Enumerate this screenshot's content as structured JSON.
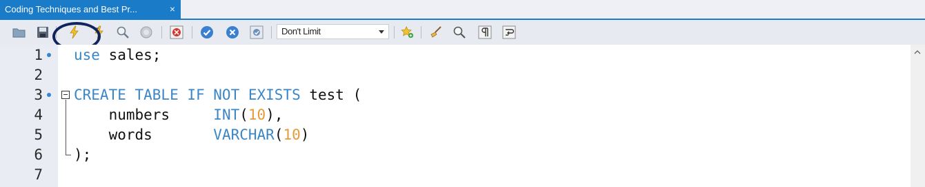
{
  "tab": {
    "title": "Coding Techniques and Best Pr...",
    "close": "×"
  },
  "toolbar": {
    "limit_select": {
      "value": "Don't Limit"
    },
    "icons": [
      "open-folder-icon",
      "save-icon",
      "execute-lightning-icon",
      "execute-current-lightning-icon",
      "explain-magnifier-icon",
      "stop-icon",
      "toggle-error-icon",
      "commit-check-icon",
      "rollback-x-icon",
      "autocommit-icon",
      "bookmark-star-icon",
      "beautify-broom-icon",
      "find-icon",
      "invisible-chars-icon",
      "wrap-icon"
    ]
  },
  "editor": {
    "lines": [
      {
        "number": "1",
        "tokens": [
          {
            "t": "use",
            "c": "kw"
          },
          {
            "t": " sales;",
            "c": ""
          }
        ]
      },
      {
        "number": "2",
        "tokens": []
      },
      {
        "number": "3",
        "tokens": [
          {
            "t": "CREATE TABLE IF NOT EXISTS",
            "c": "kw"
          },
          {
            "t": " test (",
            "c": ""
          }
        ]
      },
      {
        "number": "4",
        "tokens": [
          {
            "t": "    numbers     ",
            "c": ""
          },
          {
            "t": "INT",
            "c": "kw"
          },
          {
            "t": "(",
            "c": ""
          },
          {
            "t": "10",
            "c": "num"
          },
          {
            "t": "),",
            "c": ""
          }
        ]
      },
      {
        "number": "5",
        "tokens": [
          {
            "t": "    words       ",
            "c": ""
          },
          {
            "t": "VARCHAR",
            "c": "kw"
          },
          {
            "t": "(",
            "c": ""
          },
          {
            "t": "10",
            "c": "num"
          },
          {
            "t": ")",
            "c": ""
          }
        ]
      },
      {
        "number": "6",
        "tokens": [
          {
            "t": ");",
            "c": ""
          }
        ]
      },
      {
        "number": "7",
        "tokens": []
      }
    ],
    "breakpoints": [
      "1",
      "3"
    ]
  },
  "colors": {
    "tab_active": "#1a7bc9",
    "keyword": "#3a86c6",
    "number": "#e69a3a",
    "highlight_ring": "#12235e"
  }
}
